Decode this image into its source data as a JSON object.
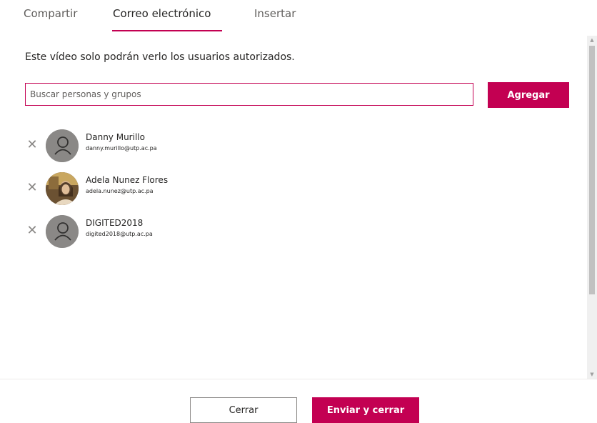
{
  "tabs": [
    {
      "label": "Compartir",
      "active": false
    },
    {
      "label": "Correo electrónico",
      "active": true
    },
    {
      "label": "Insertar",
      "active": false
    }
  ],
  "notice": "Este vídeo solo podrán verlo los usuarios autorizados.",
  "search": {
    "placeholder": "Buscar personas y grupos",
    "value": ""
  },
  "add_button": "Agregar",
  "people": [
    {
      "name": "Danny Murillo",
      "email": "danny.murillo@utp.ac.pa",
      "avatar": "person-placeholder-icon"
    },
    {
      "name": "Adela Nunez Flores",
      "email": "adela.nunez@utp.ac.pa",
      "avatar": "profile-photo"
    },
    {
      "name": "DIGITED2018",
      "email": "digited2018@utp.ac.pa",
      "avatar": "person-placeholder-icon"
    }
  ],
  "footer": {
    "close_label": "Cerrar",
    "send_label": "Enviar y cerrar"
  },
  "colors": {
    "accent": "#c30052",
    "avatar_gray": "#8a8886"
  }
}
